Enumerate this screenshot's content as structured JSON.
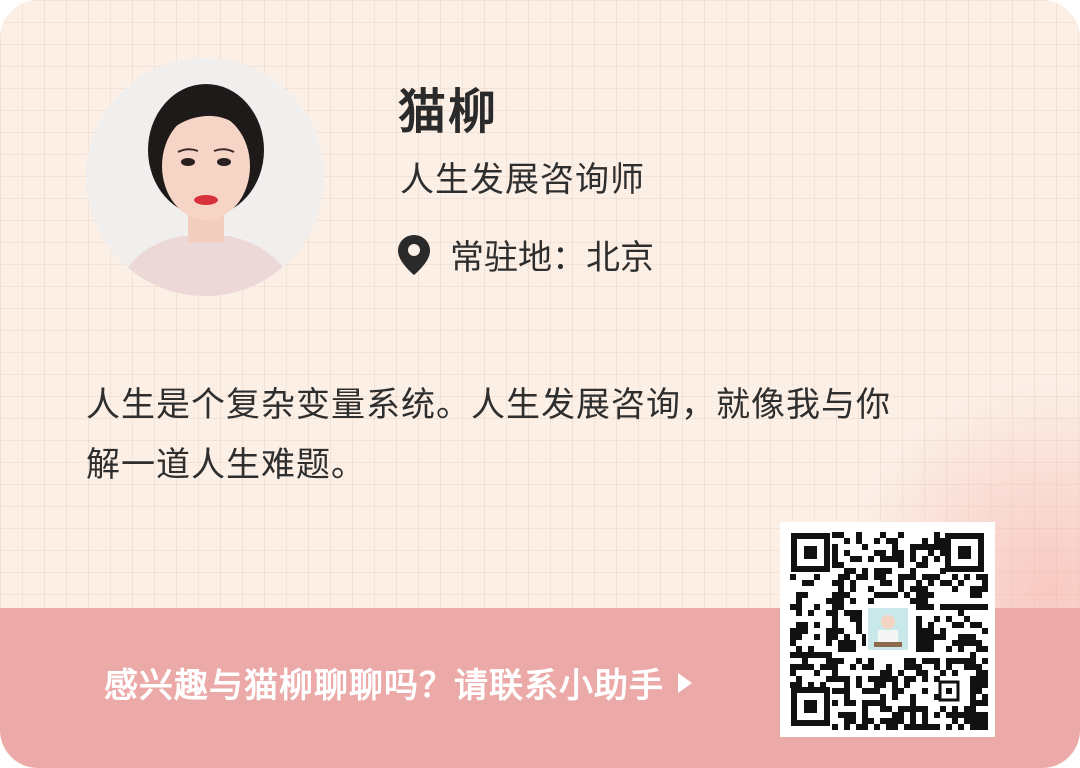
{
  "profile": {
    "name": "猫柳",
    "title": "人生发展咨询师",
    "location": "常驻地：北京",
    "bio_line1": "人生是个复杂变量系统。人生发展咨询，就像我与你",
    "bio_line2": "解一道人生难题。"
  },
  "cta": {
    "label": "感兴趣与猫柳聊聊吗？请联系小助手"
  },
  "icons": {
    "location": "map-pin-icon",
    "cta_arrow": "play-arrow-icon"
  },
  "colors": {
    "background": "#fbefe6",
    "banner": "#eba9a8",
    "text": "#2e2e2e"
  }
}
